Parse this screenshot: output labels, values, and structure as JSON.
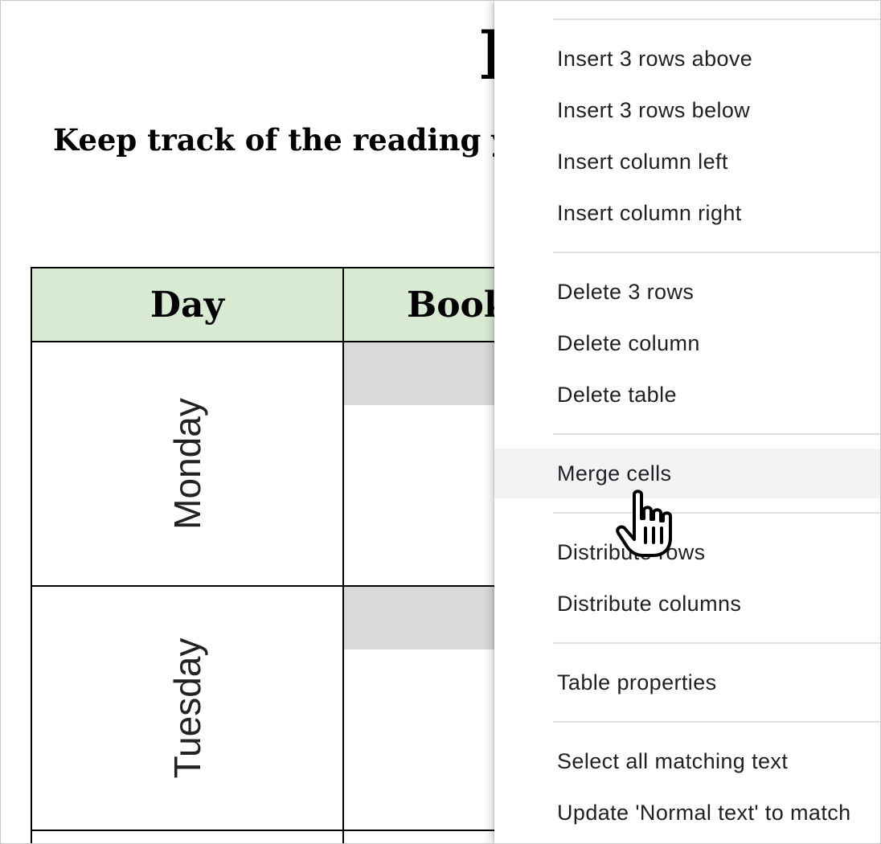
{
  "document": {
    "title_fragment": "I",
    "subtitle": "Keep track of the reading you",
    "table": {
      "headers": [
        "Day",
        "Book"
      ],
      "rows": [
        {
          "day": "Monday"
        },
        {
          "day": "Tuesday"
        }
      ]
    }
  },
  "context_menu": {
    "groups": [
      [
        "Insert 3 rows above",
        "Insert 3 rows below",
        "Insert column left",
        "Insert column right"
      ],
      [
        "Delete 3 rows",
        "Delete column",
        "Delete table"
      ],
      [
        "Merge cells"
      ],
      [
        "Distribute rows",
        "Distribute columns"
      ],
      [
        "Table properties"
      ],
      [
        "Select all matching text",
        "Update 'Normal text' to match"
      ]
    ],
    "hovered_item": "Merge cells"
  },
  "cursor": {
    "icon": "hand-pointer-icon"
  }
}
